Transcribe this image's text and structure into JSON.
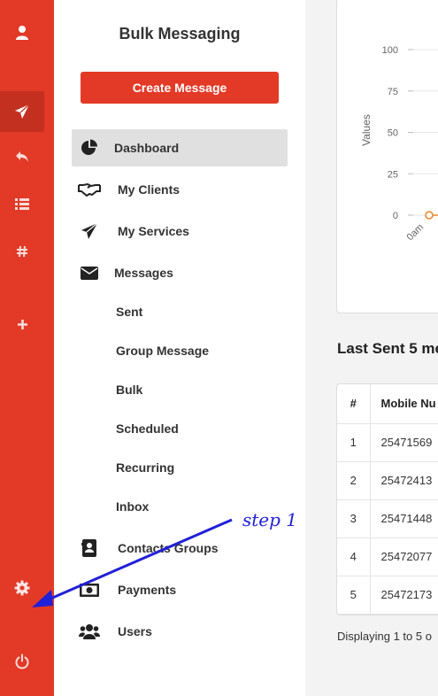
{
  "app": {
    "title": "Bulk Messaging",
    "create_button": "Create Message"
  },
  "rail": [
    {
      "name": "user-icon",
      "active": false
    },
    {
      "name": "send-icon",
      "active": true
    },
    {
      "name": "reply-icon",
      "active": false
    },
    {
      "name": "list-icon",
      "active": false
    },
    {
      "name": "hashtag-icon",
      "active": false
    },
    {
      "name": "plus-icon",
      "active": false
    },
    {
      "name": "gear-icon",
      "active": false
    },
    {
      "name": "power-icon",
      "active": false
    }
  ],
  "nav": {
    "dashboard": "Dashboard",
    "clients": "My Clients",
    "services": "My Services",
    "messages": "Messages",
    "sent": "Sent",
    "group_message": "Group Message",
    "bulk": "Bulk",
    "scheduled": "Scheduled",
    "recurring": "Recurring",
    "inbox": "Inbox",
    "contacts_groups": "Contacts Groups",
    "payments": "Payments",
    "users": "Users"
  },
  "chart_data": {
    "type": "line",
    "ylabel": "Values",
    "yticks": [
      "100",
      "75",
      "50",
      "25",
      "0"
    ],
    "ylim": [
      0,
      100
    ],
    "x": [
      "0am"
    ],
    "series": [
      {
        "values": [
          0
        ]
      }
    ]
  },
  "recent": {
    "title": "Last Sent 5 me",
    "columns": [
      "#",
      "Mobile Nu"
    ],
    "rows": [
      {
        "idx": "1",
        "mobile": "25471569"
      },
      {
        "idx": "2",
        "mobile": "25472413"
      },
      {
        "idx": "3",
        "mobile": "25471448"
      },
      {
        "idx": "4",
        "mobile": "25472077"
      },
      {
        "idx": "5",
        "mobile": "25472173"
      }
    ],
    "footer": "Displaying 1 to 5 o"
  },
  "annotation": {
    "label": "step 1"
  },
  "colors": {
    "accent": "#e23a27",
    "rail_active": "#c4301f",
    "annotation": "#2020d8",
    "chart_point": "#e8862a"
  }
}
